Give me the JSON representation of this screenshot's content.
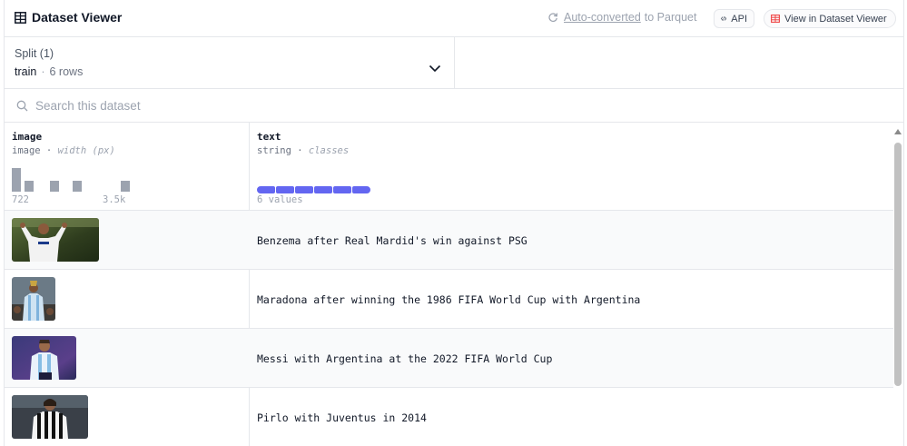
{
  "header": {
    "title": "Dataset Viewer",
    "auto_converted_link": "Auto-converted",
    "auto_converted_suffix": "to Parquet",
    "api_label": "API",
    "view_label": "View in Dataset Viewer"
  },
  "split": {
    "label": "Split (1)",
    "value": "train",
    "separator": "·",
    "rows": "6 rows"
  },
  "search": {
    "placeholder": "Search this dataset"
  },
  "columns": [
    {
      "name": "image",
      "type": "image",
      "stat": "width (px)",
      "hist_min": "722",
      "hist_max": "3.5k"
    },
    {
      "name": "text",
      "type": "string",
      "stat": "classes",
      "values": "6 values"
    }
  ],
  "histogram_levels": [
    1.0,
    0.45,
    0.45,
    0.45,
    0.45
  ],
  "rows": [
    {
      "text": "Benzema after Real Mardid's win against PSG"
    },
    {
      "text": "Maradona after winning the 1986 FIFA World Cup with Argentina"
    },
    {
      "text": "Messi with Argentina at the 2022 FIFA World Cup"
    },
    {
      "text": "Pirlo with Juventus in 2014"
    }
  ],
  "colors": {
    "accent": "#6366f1",
    "hist_bar": "#9ca3af",
    "api_icon": "#374151",
    "view_icon": "#ef4444"
  }
}
